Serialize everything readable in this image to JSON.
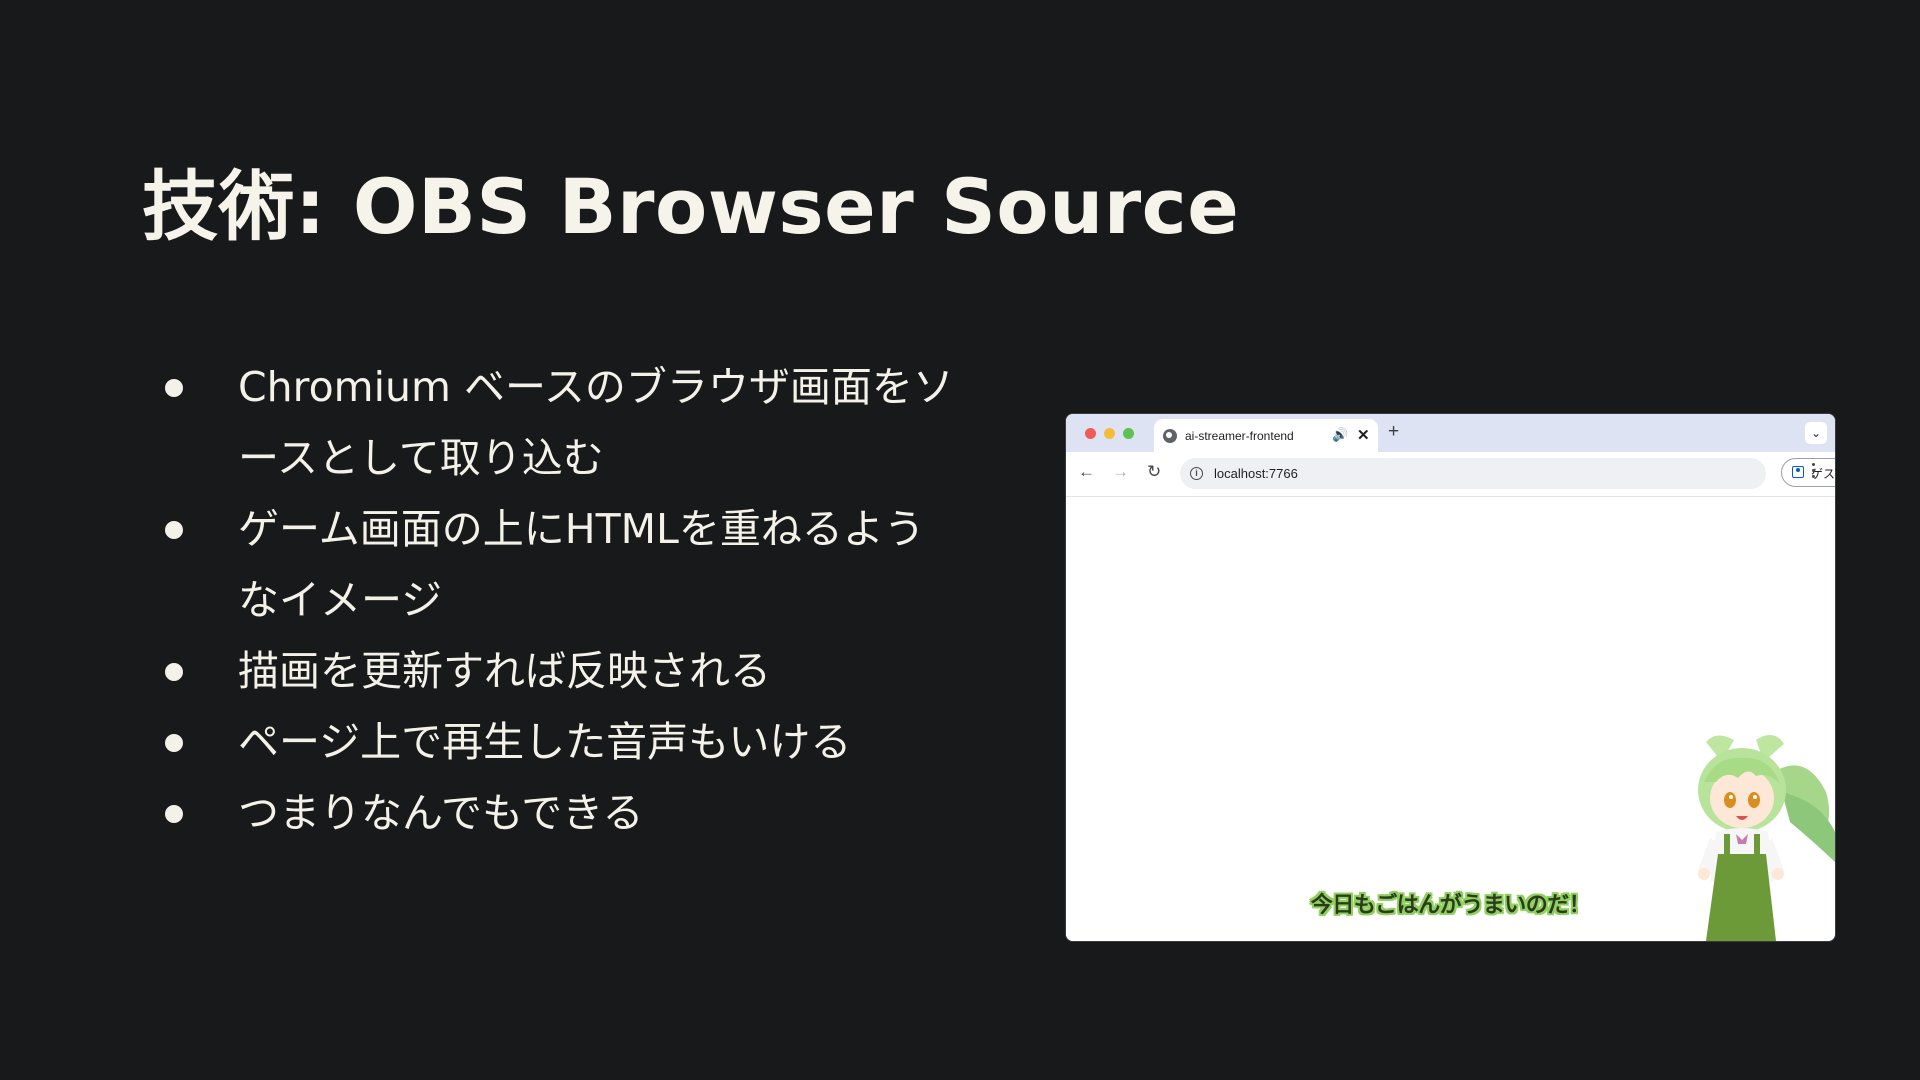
{
  "slide": {
    "title": "技術: OBS Browser Source",
    "bullets": [
      "Chromium ベースのブラウザ画面をソースとして取り込む",
      "ゲーム画面の上にHTMLを重ねるようなイメージ",
      "描画を更新すれば反映される",
      "ページ上で再生した音声もいける",
      "つまりなんでもできる"
    ]
  },
  "browser": {
    "tab_title": "ai-streamer-frontend",
    "new_tab_label": "+",
    "close_label": "✕",
    "url": "localhost:7766",
    "guest_label": "ゲスト",
    "subtitle": "今日もごはんがうまいのだ！",
    "icons": {
      "back": "arrow-left-icon",
      "forward": "arrow-right-icon",
      "reload": "reload-icon",
      "info": "info-icon",
      "audio": "speaker-icon",
      "tab_search": "chevron-down-icon"
    }
  },
  "colors": {
    "background": "#18191b",
    "text": "#f3f1e8",
    "tabbar": "#dde3f3",
    "subtitle_outline": "#8fd15c"
  }
}
